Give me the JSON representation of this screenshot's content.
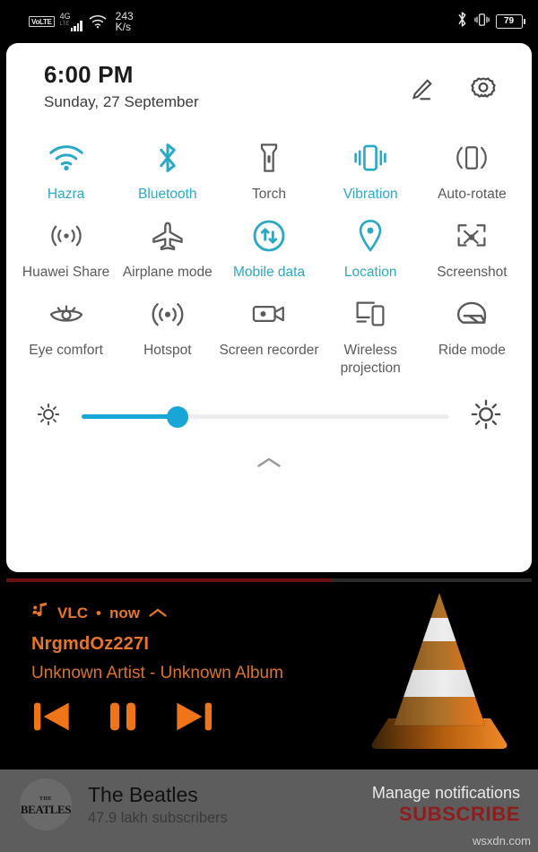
{
  "statusbar": {
    "volte": "VoLTE",
    "network_type": "4G",
    "network_sub": "LTE",
    "data_rate_value": "243",
    "data_rate_unit": "K/s",
    "bluetooth_icon": "bluetooth-icon",
    "vibrate_icon": "vibrate-icon",
    "battery_percent": "79"
  },
  "quick_settings": {
    "time": "6:00 PM",
    "date": "Sunday, 27 September",
    "edit_icon": "edit-pencil-icon",
    "settings_icon": "gear-icon",
    "accent_color": "#2aa9c4",
    "inactive_color": "#5a5a5a",
    "tiles": [
      [
        {
          "label": "Hazra",
          "icon": "wifi-icon",
          "active": true
        },
        {
          "label": "Bluetooth",
          "icon": "bluetooth-icon",
          "active": true
        },
        {
          "label": "Torch",
          "icon": "flashlight-icon",
          "active": false
        },
        {
          "label": "Vibration",
          "icon": "vibration-icon",
          "active": true
        },
        {
          "label": "Auto-rotate",
          "icon": "auto-rotate-icon",
          "active": false
        }
      ],
      [
        {
          "label": "Huawei Share",
          "icon": "huawei-share-icon",
          "active": false
        },
        {
          "label": "Airplane mode",
          "icon": "airplane-icon",
          "active": false
        },
        {
          "label": "Mobile data",
          "icon": "mobile-data-icon",
          "active": true
        },
        {
          "label": "Location",
          "icon": "location-pin-icon",
          "active": true
        },
        {
          "label": "Screenshot",
          "icon": "screenshot-icon",
          "active": false
        }
      ],
      [
        {
          "label": "Eye comfort",
          "icon": "eye-comfort-icon",
          "active": false
        },
        {
          "label": "Hotspot",
          "icon": "hotspot-icon",
          "active": false
        },
        {
          "label": "Screen recorder",
          "icon": "screen-recorder-icon",
          "active": false
        },
        {
          "label": "Wireless projection",
          "icon": "wireless-projection-icon",
          "active": false
        },
        {
          "label": "Ride mode",
          "icon": "ride-mode-icon",
          "active": false
        }
      ]
    ],
    "brightness": {
      "low_icon": "brightness-low-icon",
      "high_icon": "brightness-high-icon",
      "value_percent": 26,
      "fill_color": "#17a6d6"
    },
    "collapse_icon": "chevron-up-icon"
  },
  "vlc_notification": {
    "app_icon": "music-note-icon",
    "app_name": "VLC",
    "separator": "•",
    "time_label": "now",
    "expand_icon": "chevron-up-icon",
    "track_title": "NrgmdOz227I",
    "track_subtitle": "Unknown Artist - Unknown Album",
    "accent_color": "#e8762a",
    "progress_percent": 62,
    "progress_color": "#6d0f0f",
    "controls": [
      {
        "name": "previous-button",
        "icon": "skip-previous-icon"
      },
      {
        "name": "pause-button",
        "icon": "pause-icon"
      },
      {
        "name": "next-button",
        "icon": "skip-next-icon"
      }
    ],
    "album_art": "vlc-traffic-cone-logo"
  },
  "youtube_bar": {
    "avatar_main": "BEATLES",
    "avatar_top": "THE",
    "channel_name": "The Beatles",
    "subscriber_count": "47.9 lakh subscribers",
    "manage_label": "Manage notifications",
    "subscribe_label": "SUBSCRIBE",
    "subscribe_color": "#8e1d1d"
  },
  "watermark": "wsxdn.com"
}
